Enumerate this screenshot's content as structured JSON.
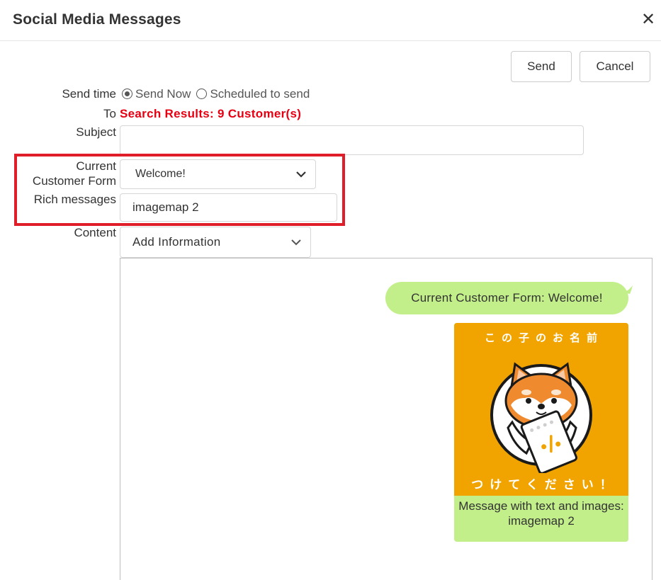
{
  "dialog": {
    "title": "Social Media Messages",
    "close_icon": "close-icon"
  },
  "toolbar": {
    "send_label": "Send",
    "cancel_label": "Cancel"
  },
  "form": {
    "send_time_label": "Send time",
    "send_now_label": "Send Now",
    "scheduled_label": "Scheduled to send",
    "send_time_selected": "Send Now",
    "to_label": "To",
    "to_value": "Search Results: 9 Customer(s)",
    "subject_label": "Subject",
    "subject_value": "",
    "ccf_label_line1": "Current",
    "ccf_label_line2": "Customer Form",
    "ccf_value": "Welcome!",
    "rich_label": "Rich messages",
    "rich_value": "imagemap 2",
    "content_label": "Content",
    "content_value": "Add Information"
  },
  "preview": {
    "bubble_text": "Current Customer Form: Welcome!",
    "image_top_text": "この子のお名前",
    "image_bottom_text": "つけてください！",
    "caption": "Message with text and images: imagemap 2"
  },
  "colors": {
    "highlight": "#e01e2a",
    "to_value": "#e60012",
    "bubble": "#c2ef8a",
    "image_bg": "#f1a400"
  }
}
